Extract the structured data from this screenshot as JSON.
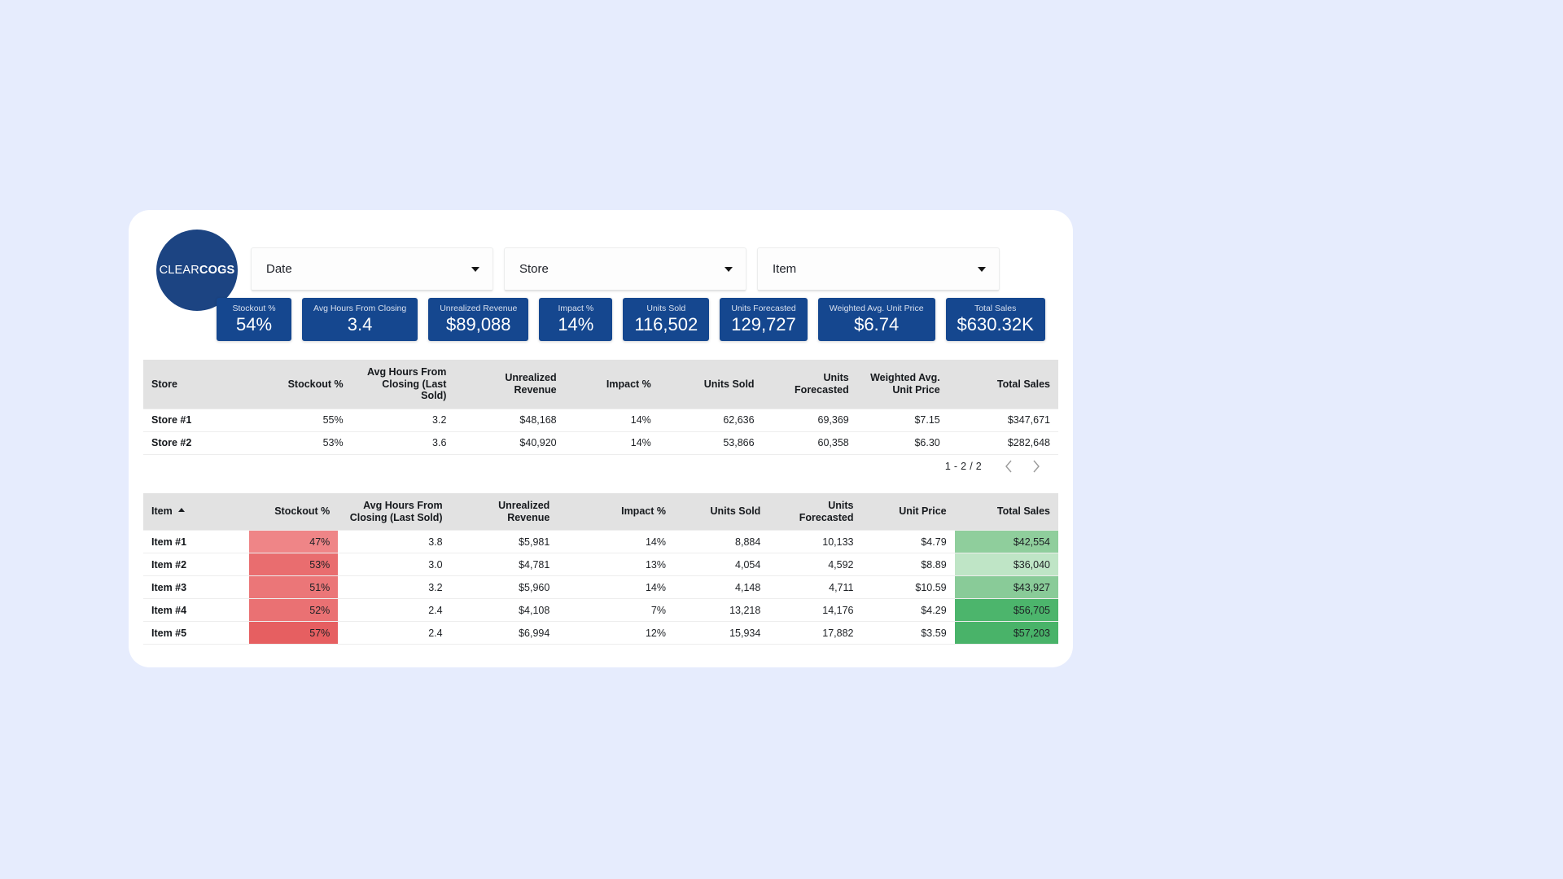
{
  "brand": {
    "logo_light": "CLEAR",
    "logo_bold": "COGS",
    "primary_color": "#15478f",
    "logo_bg": "#1c4482",
    "page_bg": "#e6ecfd"
  },
  "filters": [
    {
      "name": "date",
      "label": "Date",
      "icon": "chevron-down-icon"
    },
    {
      "name": "store",
      "label": "Store",
      "icon": "chevron-down-icon"
    },
    {
      "name": "item",
      "label": "Item",
      "icon": "chevron-down-icon"
    }
  ],
  "kpis": [
    {
      "label": "Stockout %",
      "value": "54%"
    },
    {
      "label": "Avg Hours From Closing",
      "value": "3.4"
    },
    {
      "label": "Unrealized Revenue",
      "value": "$89,088"
    },
    {
      "label": "Impact %",
      "value": "14%"
    },
    {
      "label": "Units Sold",
      "value": "116,502"
    },
    {
      "label": "Units Forecasted",
      "value": "129,727"
    },
    {
      "label": "Weighted Avg. Unit Price",
      "value": "$6.74"
    },
    {
      "label": "Total Sales",
      "value": "$630.32K"
    }
  ],
  "store_table": {
    "columns": [
      "Store",
      "Stockout %",
      "Avg Hours From Closing (Last Sold)",
      "Unrealized Revenue",
      "Impact %",
      "Units Sold",
      "Units Forecasted",
      "Weighted Avg. Unit Price",
      "Total Sales"
    ],
    "rows": [
      {
        "store": "Store #1",
        "stockout": "55%",
        "avg_hours": "3.2",
        "unrealized": "$48,168",
        "impact": "14%",
        "units_sold": "62,636",
        "units_forecasted": "69,369",
        "unit_price": "$7.15",
        "total_sales": "$347,671"
      },
      {
        "store": "Store #2",
        "stockout": "53%",
        "avg_hours": "3.6",
        "unrealized": "$40,920",
        "impact": "14%",
        "units_sold": "53,866",
        "units_forecasted": "60,358",
        "unit_price": "$6.30",
        "total_sales": "$282,648"
      }
    ],
    "pagination": {
      "range_label": "1 - 2 / 2",
      "prev_icon": "chevron-left-icon",
      "next_icon": "chevron-right-icon"
    }
  },
  "item_table": {
    "columns": [
      "Item",
      "Stockout %",
      "Avg Hours From Closing (Last Sold)",
      "Unrealized Revenue",
      "Impact %",
      "Units Sold",
      "Units Forecasted",
      "Unit Price",
      "Total Sales"
    ],
    "sort": {
      "column": "Item",
      "direction": "asc",
      "icon": "sort-ascending-icon"
    },
    "rows": [
      {
        "item": "Item #1",
        "stockout": "47%",
        "stockout_bg": "#ef8587",
        "avg_hours": "3.8",
        "unrealized": "$5,981",
        "impact": "14%",
        "units_sold": "8,884",
        "units_forecasted": "10,133",
        "unit_price": "$4.79",
        "total_sales": "$42,554",
        "total_sales_bg": "#8fce9c"
      },
      {
        "item": "Item #2",
        "stockout": "53%",
        "stockout_bg": "#e96d6f",
        "avg_hours": "3.0",
        "unrealized": "$4,781",
        "impact": "13%",
        "units_sold": "4,054",
        "units_forecasted": "4,592",
        "unit_price": "$8.89",
        "total_sales": "$36,040",
        "total_sales_bg": "#bfe5c6"
      },
      {
        "item": "Item #3",
        "stockout": "51%",
        "stockout_bg": "#eb7678",
        "avg_hours": "3.2",
        "unrealized": "$5,960",
        "impact": "14%",
        "units_sold": "4,148",
        "units_forecasted": "4,711",
        "unit_price": "$10.59",
        "total_sales": "$43,927",
        "total_sales_bg": "#89cb98"
      },
      {
        "item": "Item #4",
        "stockout": "52%",
        "stockout_bg": "#ea7173",
        "avg_hours": "2.4",
        "unrealized": "$4,108",
        "impact": "7%",
        "units_sold": "13,218",
        "units_forecasted": "14,176",
        "unit_price": "$4.29",
        "total_sales": "$56,705",
        "total_sales_bg": "#4cb56c"
      },
      {
        "item": "Item #5",
        "stockout": "57%",
        "stockout_bg": "#e65f61",
        "avg_hours": "2.4",
        "unrealized": "$6,994",
        "impact": "12%",
        "units_sold": "15,934",
        "units_forecasted": "17,882",
        "unit_price": "$3.59",
        "total_sales": "$57,203",
        "total_sales_bg": "#49b369"
      }
    ]
  }
}
